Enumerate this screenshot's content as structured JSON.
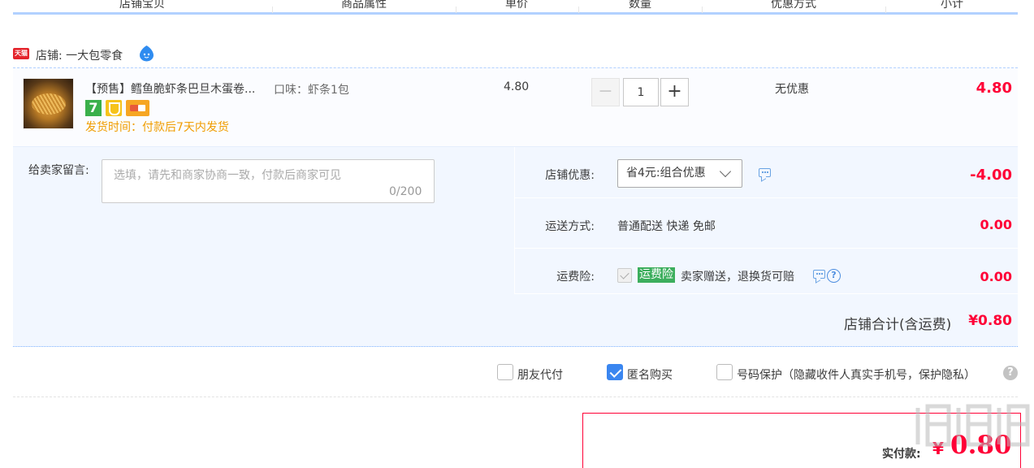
{
  "header": {
    "columns": [
      "店铺宝贝",
      "商品属性",
      "单价",
      "数量",
      "优惠方式",
      "小计"
    ]
  },
  "shop": {
    "badge": "天猫",
    "name": "店铺: 一大包零食"
  },
  "item": {
    "title": "【预售】鳕鱼脆虾条巴旦木蛋卷...",
    "attribute": "口味：虾条1包",
    "service_badge": "7",
    "ship_time": "发货时间：付款后7天内发货",
    "unit_price": "4.80",
    "quantity": "1",
    "minus_label": "−",
    "plus_label": "+",
    "discount": "无优惠",
    "subtotal": "4.80"
  },
  "message": {
    "label": "给卖家留言:",
    "placeholder": "选填，请先和商家协商一致，付款后商家可见",
    "counter": "0/200"
  },
  "options": {
    "coupon_label": "店铺优惠:",
    "coupon_selected": "省4元:组合优惠",
    "coupon_value": "-4.00",
    "shipping_label": "运送方式:",
    "shipping_method": "普通配送 快递 免邮",
    "shipping_value": "0.00",
    "insurance_label": "运费险:",
    "insurance_tag": "运费险",
    "insurance_text": "卖家赠送，退换货可赔",
    "insurance_help": "?",
    "insurance_value": "0.00"
  },
  "shop_total": {
    "label": "店铺合计(含运费)",
    "value": "¥0.80"
  },
  "checkout_options": [
    {
      "label": "朋友代付",
      "checked": false
    },
    {
      "label": "匿名购买",
      "checked": true
    },
    {
      "label": "号码保护（隐藏收件人真实手机号，保护隐私）",
      "checked": false
    }
  ],
  "help_glyph": "?",
  "payment": {
    "label": "实付款:",
    "currency": "¥",
    "value": "0.80"
  },
  "colors": {
    "accent_red": "#ff0036",
    "header_blue": "#b2d1ff",
    "row_bg": "#f2f7ff",
    "ship_orange": "#f09d00",
    "insurance_green": "#3cae5d",
    "checkbox_blue": "#3a86f0"
  }
}
